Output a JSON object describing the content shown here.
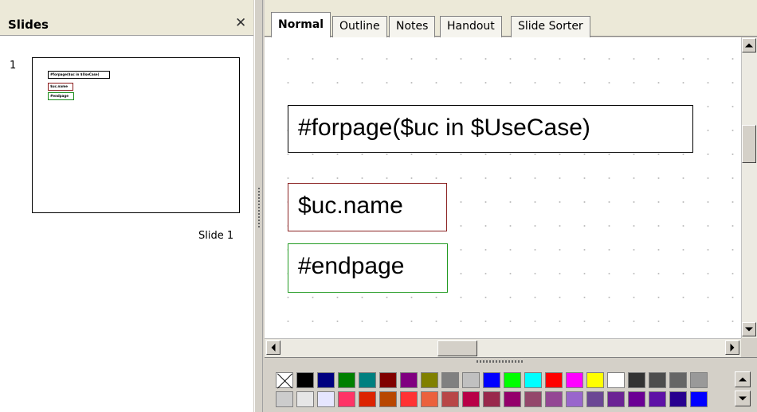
{
  "slides_panel": {
    "title": "Slides",
    "close_glyph": "✕",
    "slides": [
      {
        "number": "1",
        "label": "Slide 1",
        "thumb_texts": [
          "#forpage($uc in $UseCase)",
          "$uc.name",
          "#endpage"
        ]
      }
    ]
  },
  "tabs": [
    {
      "label": "Normal",
      "active": true
    },
    {
      "label": "Outline",
      "active": false
    },
    {
      "label": "Notes",
      "active": false
    },
    {
      "label": "Handout",
      "active": false
    },
    {
      "label": "Slide Sorter",
      "active": false
    }
  ],
  "slide": {
    "shapes": [
      {
        "text": "#forpage($uc in $UseCase)",
        "border_color": "#000000"
      },
      {
        "text": "$uc.name",
        "border_color": "#8b2222"
      },
      {
        "text": "#endpage",
        "border_color": "#229a22"
      }
    ]
  },
  "color_palette": {
    "row1": [
      "none",
      "#000000",
      "#000080",
      "#008000",
      "#008080",
      "#800000",
      "#800080",
      "#808000",
      "#808080",
      "#c0c0c0",
      "#0000ff",
      "#00ff00",
      "#00ffff",
      "#ff0000",
      "#ff00ff",
      "#ffff00",
      "#ffffff",
      "#333333",
      "#4d4d4d",
      "#666666",
      "#999999"
    ],
    "row2": [
      "#cccccc",
      "#e6e6e6",
      "#e6e6ff",
      "#ff3366",
      "#dc2300",
      "#b84700",
      "#ff3333",
      "#eb613d",
      "#b84747",
      "#b80047",
      "#99284c",
      "#94006b",
      "#94476b",
      "#944794",
      "#9966cc",
      "#6b4794",
      "#6b2394",
      "#6b0094",
      "#5e11a6",
      "#28008f",
      "#0000ff"
    ]
  }
}
